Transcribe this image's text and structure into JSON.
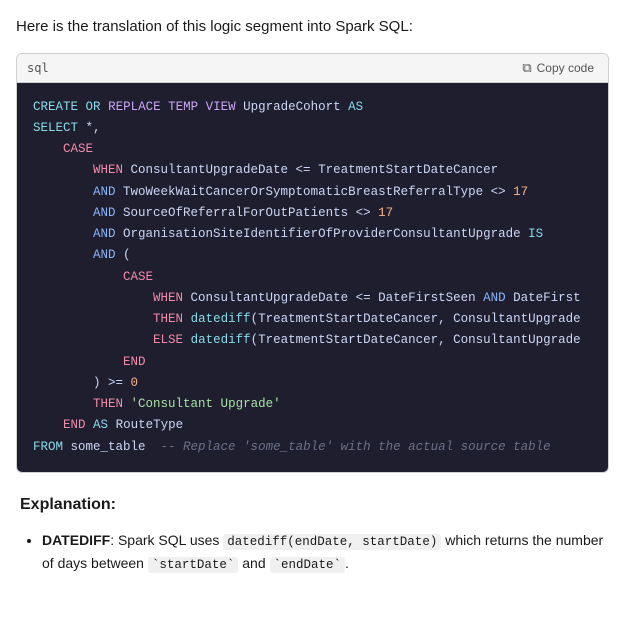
{
  "intro": {
    "text": "Here is the translation of this logic segment into Spark SQL:"
  },
  "code_block": {
    "lang_label": "sql",
    "copy_button_label": "Copy code",
    "lines": []
  },
  "explanation": {
    "heading": "Explanation:",
    "items": [
      {
        "term": "DATEDIFF",
        "description_before": ": Spark SQL uses ",
        "code1": "datediff(endDate, startDate)",
        "description_middle": " which returns the number of days between ",
        "code2": "startDate",
        "description_after": " and ",
        "code3": "endDate",
        "description_end": "."
      }
    ]
  }
}
